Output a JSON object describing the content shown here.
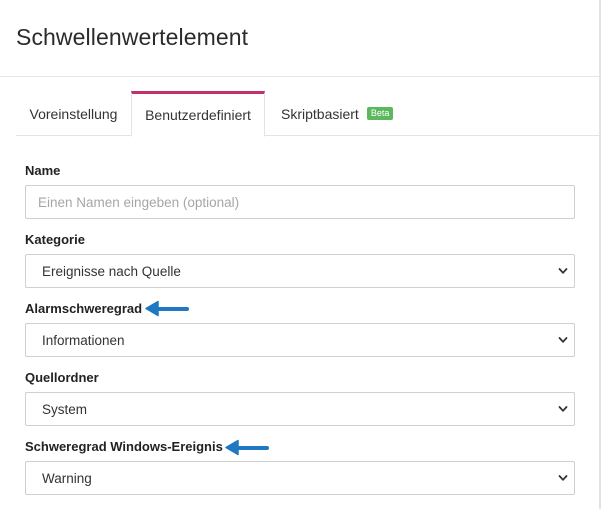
{
  "window": {
    "title": "Schwellenwertelement"
  },
  "tabs": [
    {
      "label": "Voreinstellung",
      "active": false
    },
    {
      "label": "Benutzerdefiniert",
      "active": true
    },
    {
      "label": "Skriptbasiert",
      "badge": "Beta",
      "active": false
    }
  ],
  "form": {
    "name": {
      "label": "Name",
      "value": "",
      "placeholder": "Einen Namen eingeben (optional)"
    },
    "category": {
      "label": "Kategorie",
      "selected": "Ereignisse nach Quelle"
    },
    "alarm_severity": {
      "label": "Alarmschweregrad",
      "selected": "Informationen"
    },
    "source_folder": {
      "label": "Quellordner",
      "selected": "System"
    },
    "windows_event_severity": {
      "label": "Schweregrad Windows-Ereignis",
      "selected": "Warning"
    }
  },
  "colors": {
    "active_tab_accent": "#c2306f",
    "beta_badge": "#5cb85c",
    "annotation_arrow": "#1f78c1"
  },
  "icons": {
    "select_indicator": "chevron-down-icon",
    "annotation": "arrow-left-icon"
  }
}
